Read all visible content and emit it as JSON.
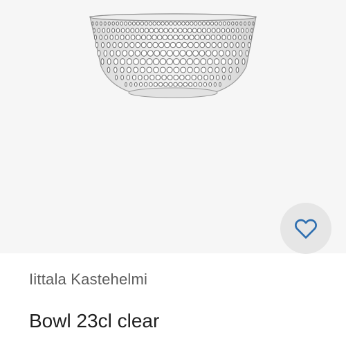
{
  "product": {
    "brand": "Iittala Kastehelmi",
    "name": "Bowl 23cl clear"
  },
  "image": {
    "subject": "glass-bowl-dewdrop-pattern"
  },
  "favorite": {
    "icon": "heart-outline-icon",
    "icon_color": "#2f6fb0",
    "button_color": "#e6e6e6"
  },
  "colors": {
    "image_background": "#f6f6f6",
    "brand_text": "#5c5c5c",
    "title_text": "#1f1f1f"
  }
}
